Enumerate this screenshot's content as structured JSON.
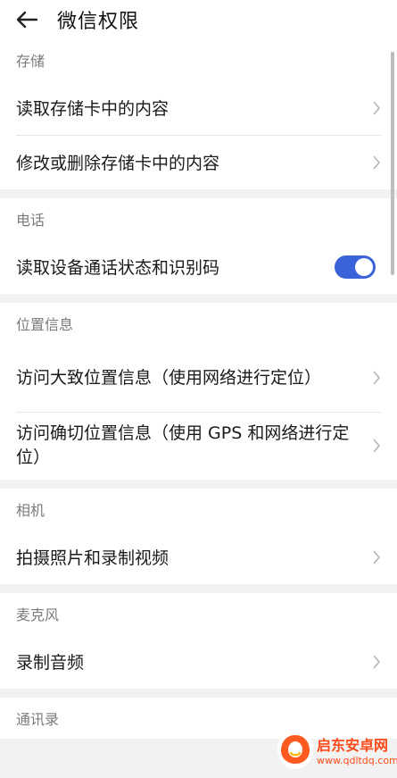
{
  "header": {
    "back_icon": "arrow-left-icon",
    "title": "微信权限"
  },
  "sections": {
    "storage": {
      "title": "存储",
      "items": [
        {
          "label": "读取存储卡中的内容",
          "control": "chevron-right-icon"
        },
        {
          "label": "修改或删除存储卡中的内容",
          "control": "chevron-right-icon"
        }
      ]
    },
    "phone": {
      "title": "电话",
      "items": [
        {
          "label": "读取设备通话状态和识别码",
          "control": "toggle",
          "enabled": true
        }
      ]
    },
    "location": {
      "title": "位置信息",
      "items": [
        {
          "label": "访问大致位置信息（使用网络进行定位）",
          "control": "chevron-right-icon"
        },
        {
          "label": "访问确切位置信息（使用 GPS 和网络进行定位）",
          "control": "chevron-right-icon"
        }
      ]
    },
    "camera": {
      "title": "相机",
      "items": [
        {
          "label": "拍摄照片和录制视频",
          "control": "chevron-right-icon"
        }
      ]
    },
    "microphone": {
      "title": "麦克风",
      "items": [
        {
          "label": "录制音频",
          "control": "chevron-right-icon"
        }
      ]
    },
    "contacts": {
      "title": "通讯录"
    }
  },
  "watermark": {
    "name": "启东安卓网",
    "url": "www.qdltdq.com"
  },
  "colors": {
    "toggle_on": "#3a62d9",
    "background": "#f2f2f2",
    "section_title": "#7b7b7b",
    "watermark": "#ff4a1a"
  }
}
